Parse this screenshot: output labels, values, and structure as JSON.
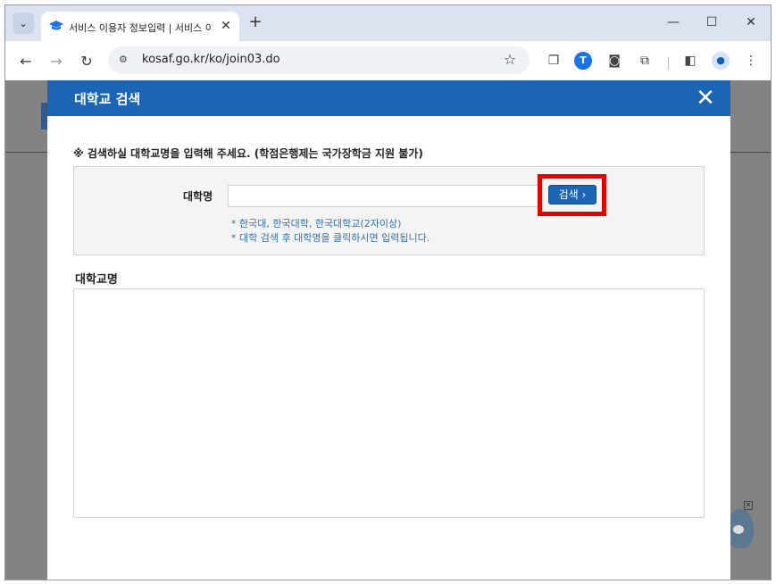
{
  "browser": {
    "tab_title": "서비스 이용자 정보입력 | 서비스 이용",
    "url": "kosaf.go.kr/ko/join03.do",
    "extension_letter": "T"
  },
  "modal": {
    "title": "대학교 검색",
    "notice": "※ 검색하실 대학교명을 입력해 주세요. (학점은행제는 국가장학금 지원 불가)",
    "search": {
      "label": "대학명",
      "value": "",
      "button_label": "검색 ›"
    },
    "hints": [
      "* 한국대, 한국대학, 한국대학교(2자이상)",
      "* 대학 검색 후 대학명을 클릭하시면 입력됩니다."
    ],
    "result_label": "대학교명",
    "results": []
  },
  "colors": {
    "header_blue": "#1c64b4",
    "highlight_red": "#e30000",
    "hint_blue": "#3a6fb0"
  },
  "icons": {
    "tab_search": "chevron-down-icon",
    "favicon": "graduation-cap-icon",
    "close": "close-icon",
    "star": "star-icon"
  }
}
